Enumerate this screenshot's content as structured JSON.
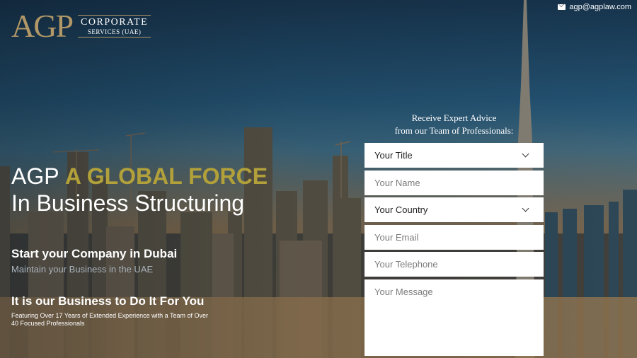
{
  "logo": {
    "mark": "AGP",
    "line1": "CORPORATE",
    "line2": "SERVICES (UAE)"
  },
  "contact": {
    "email": "agp@agplaw.com",
    "icon": "envelope-icon"
  },
  "hero": {
    "title_prefix": "AGP",
    "title_accent": "A GLOBAL FORCE",
    "title_line2": "In Business Structuring",
    "sub1": "Start your Company in Dubai",
    "sub1_desc": "Maintain your Business in the UAE",
    "sub2": "It is our Business to Do It For You",
    "sub2_desc": "Featuring Over 17 Years of Extended Experience with a Team of Over 40 Focused Professionals"
  },
  "form": {
    "heading_line1": "Receive Expert Advice",
    "heading_line2": "from our Team of Professionals:",
    "title_select": "Your Title",
    "name_placeholder": "Your Name",
    "country_select": "Your Country",
    "email_placeholder": "Your Email",
    "telephone_placeholder": "Your Telephone",
    "message_placeholder": "Your Message"
  },
  "colors": {
    "accent": "#b2a13a",
    "logo_gold": "#b29767"
  }
}
